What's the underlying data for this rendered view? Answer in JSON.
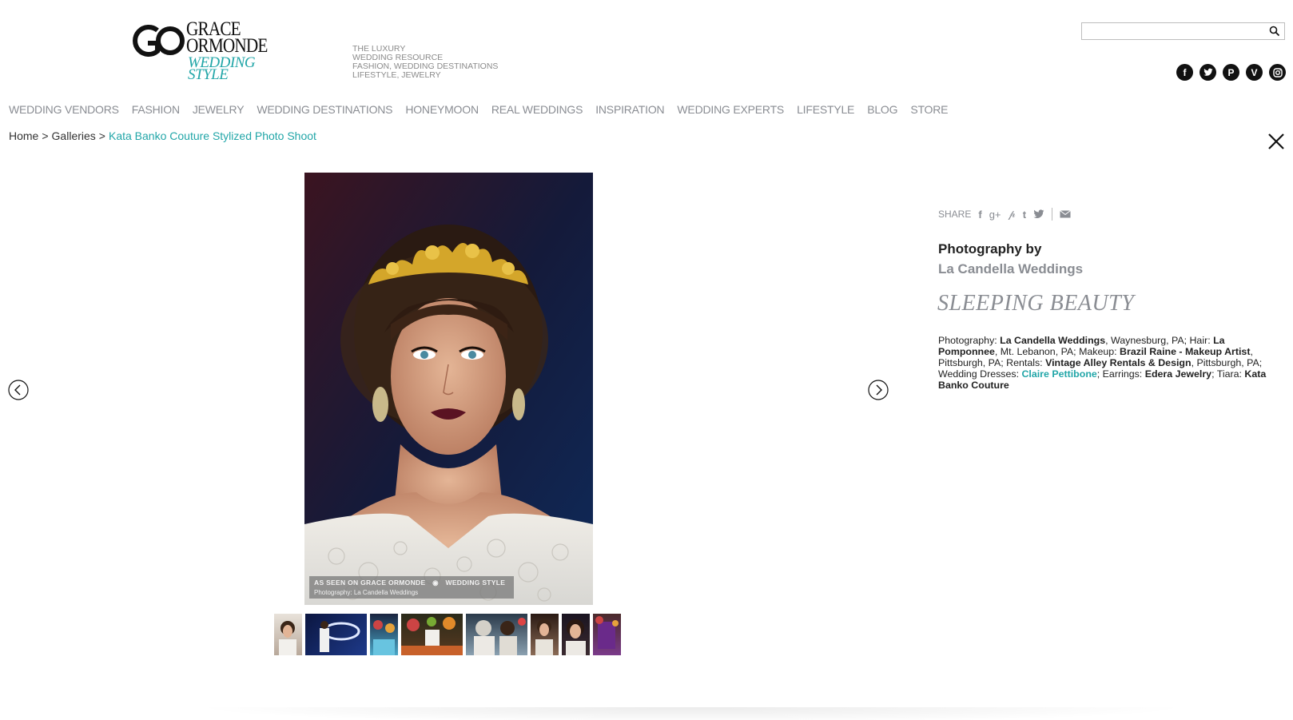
{
  "logo": {
    "line1": "GRACE",
    "line2": "ORMONDE",
    "line3": "WEDDING",
    "line4": "STYLE"
  },
  "tagline": [
    "THE LUXURY",
    "WEDDING RESOURCE",
    "FASHION, WEDDING DESTINATIONS",
    "LIFESTYLE, JEWELRY"
  ],
  "search": {
    "placeholder": "",
    "value": ""
  },
  "social": [
    "facebook-icon",
    "twitter-icon",
    "pinterest-icon",
    "vimeo-icon",
    "instagram-icon"
  ],
  "nav": [
    "WEDDING VENDORS",
    "FASHION",
    "JEWELRY",
    "WEDDING DESTINATIONS",
    "HONEYMOON",
    "REAL WEDDINGS",
    "INSPIRATION",
    "WEDDING EXPERTS",
    "LIFESTYLE",
    "BLOG",
    "STORE"
  ],
  "breadcrumb": {
    "home": "Home",
    "sep": ">",
    "galleries": "Galleries",
    "current": "Kata Banko Couture Stylized Photo Shoot"
  },
  "watermark": {
    "line1": "AS SEEN ON GRACE ORMONDE",
    "brand": "WEDDING STYLE",
    "line2": "Photography: La Candella Weddings"
  },
  "share": {
    "label": "SHARE"
  },
  "photography": {
    "label": "Photography by",
    "name": "La Candella Weddings"
  },
  "gallery_title": "SLEEPING BEAUTY",
  "credits": {
    "photography_label": "Photography: ",
    "photography_name": "La Candella Weddings",
    "photography_loc": ", Waynesburg, PA; Hair: ",
    "hair_name": "La Pomponnee",
    "hair_loc": ", Mt. Lebanon, PA; Makeup: ",
    "makeup_name": "Brazil Raine - Makeup Artist",
    "makeup_loc": ", Pittsburgh, PA; Rentals: ",
    "rentals_name": "Vintage Alley Rentals & Design",
    "rentals_loc": ", Pittsburgh, PA; Wedding Dresses: ",
    "dresses_name": "Claire Pettibone",
    "earrings_label": "; Earrings: ",
    "earrings_name": "Edera Jewelry",
    "tiara_label": "; Tiara: ",
    "tiara_name": "Kata Banko Couture"
  },
  "colors": {
    "accent": "#22a6a8",
    "nav_text": "#8a8d93",
    "text": "#222222"
  }
}
